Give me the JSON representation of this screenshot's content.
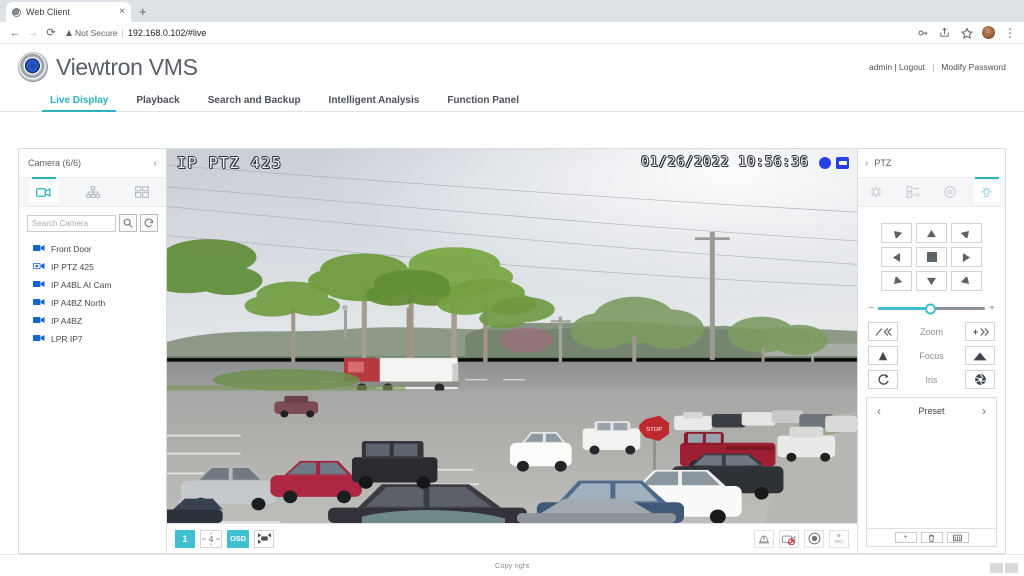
{
  "browser": {
    "tab": {
      "title": "Web Client",
      "favicon": "globe-icon",
      "close": "×"
    },
    "new_tab": "+",
    "nav": {
      "back": "←",
      "forward": "→",
      "reload": "⟳"
    },
    "security_label": "Not Secure",
    "url": "192.168.0.102/#live",
    "separator": "|",
    "toolbar_icons": [
      "key-icon",
      "share-icon",
      "star-icon",
      "profile-avatar",
      "kebab-menu-icon"
    ]
  },
  "header": {
    "brand": "Viewtron VMS",
    "user": "admin | Logout",
    "divider": "|",
    "modify_password": "Modify Password"
  },
  "nav_tabs": [
    {
      "label": "Live Display",
      "active": true
    },
    {
      "label": "Playback",
      "active": false
    },
    {
      "label": "Search and Backup",
      "active": false
    },
    {
      "label": "Intelligent Analysis",
      "active": false
    },
    {
      "label": "Function Panel",
      "active": false
    }
  ],
  "sidebar": {
    "title": "Camera (6/6)",
    "collapse": "‹",
    "tabs": [
      {
        "name": "camera-list-tab",
        "icon": "camera-icon",
        "active": true
      },
      {
        "name": "group-tree-tab",
        "icon": "tree-icon",
        "active": false
      },
      {
        "name": "layout-tab",
        "icon": "grid-icon",
        "active": false
      }
    ],
    "search": {
      "placeholder": "Search Camera",
      "value": ""
    },
    "search_button": "search-icon",
    "refresh_button": "refresh-icon",
    "cameras": [
      {
        "label": "Front Door",
        "icon": "camera-icon"
      },
      {
        "label": "IP PTZ 425",
        "icon": "ptz-camera-icon"
      },
      {
        "label": "IP A4BL AI Cam",
        "icon": "camera-icon"
      },
      {
        "label": "IP A4BZ North",
        "icon": "camera-icon"
      },
      {
        "label": "IP A4BZ",
        "icon": "camera-icon"
      },
      {
        "label": "LPR IP7",
        "icon": "camera-icon"
      }
    ]
  },
  "video": {
    "osd_name": "IP PTZ 425",
    "osd_date": "01/26/2022",
    "osd_time": "10:56:36",
    "badges": [
      "record-dot",
      "stream-badge"
    ],
    "toolbar_left": [
      {
        "label": "1",
        "name": "layout-1-button",
        "active": true
      },
      {
        "label": "4",
        "name": "layout-4-button",
        "active": false
      },
      {
        "label": "OSD",
        "name": "osd-toggle-button",
        "active": true
      },
      {
        "label": "",
        "name": "fullscreen-button",
        "active": false
      }
    ],
    "toolbar_right": [
      {
        "name": "alarm-button",
        "label": ""
      },
      {
        "name": "snapshot-disabled-button",
        "label": ""
      },
      {
        "name": "record-button",
        "label": ""
      },
      {
        "name": "rec-status-button",
        "label": "REC"
      }
    ]
  },
  "ptz": {
    "title": "PTZ",
    "collapse": "›",
    "tabs": [
      {
        "name": "ptz-cruise-tab",
        "icon": "cruise-icon",
        "active": false
      },
      {
        "name": "ptz-track-tab",
        "icon": "track-icon",
        "active": false
      },
      {
        "name": "ptz-autoscan-tab",
        "icon": "autoscan-icon",
        "active": false
      },
      {
        "name": "ptz-control-tab",
        "icon": "ptz-control-icon",
        "active": true
      }
    ],
    "dpad": [
      {
        "name": "pan-up-left-button",
        "dir": "up-left"
      },
      {
        "name": "pan-up-button",
        "dir": "up"
      },
      {
        "name": "pan-up-right-button",
        "dir": "up-right"
      },
      {
        "name": "pan-left-button",
        "dir": "left"
      },
      {
        "name": "stop-button",
        "dir": "stop"
      },
      {
        "name": "pan-right-button",
        "dir": "right"
      },
      {
        "name": "pan-down-left-button",
        "dir": "down-left"
      },
      {
        "name": "pan-down-button",
        "dir": "down"
      },
      {
        "name": "pan-down-right-button",
        "dir": "down-right"
      }
    ],
    "speed": {
      "min": "−",
      "max": "+",
      "value": 48
    },
    "controls": [
      {
        "label": "Zoom",
        "out": "zoom-out-icon",
        "in": "zoom-in-icon"
      },
      {
        "label": "Focus",
        "out": "focus-near-icon",
        "in": "focus-far-icon"
      },
      {
        "label": "Iris",
        "out": "iris-close-icon",
        "in": "iris-open-icon"
      }
    ],
    "preset": {
      "title": "Preset",
      "prev": "‹",
      "next": "›",
      "actions": [
        {
          "name": "add-preset-button",
          "label": "+"
        },
        {
          "name": "delete-preset-button",
          "label": "🗑"
        },
        {
          "name": "edit-preset-button",
          "label": "✎"
        }
      ]
    }
  },
  "footer": {
    "copyright": "Copy right"
  }
}
